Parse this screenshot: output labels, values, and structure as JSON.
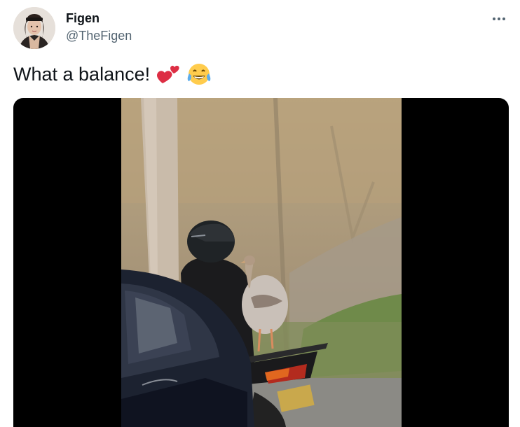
{
  "author": {
    "display_name": "Figen",
    "handle": "@TheFigen",
    "avatar_icon": "profile-photo"
  },
  "tweet": {
    "text": "What a balance!",
    "emojis": [
      "two-hearts-icon",
      "tears-of-joy-icon"
    ]
  },
  "media": {
    "type": "video",
    "description_icon": "video-frame"
  },
  "more_icon": "more-options-icon",
  "colors": {
    "text_primary": "#0f1419",
    "text_secondary": "#536471",
    "media_background": "#000000"
  }
}
